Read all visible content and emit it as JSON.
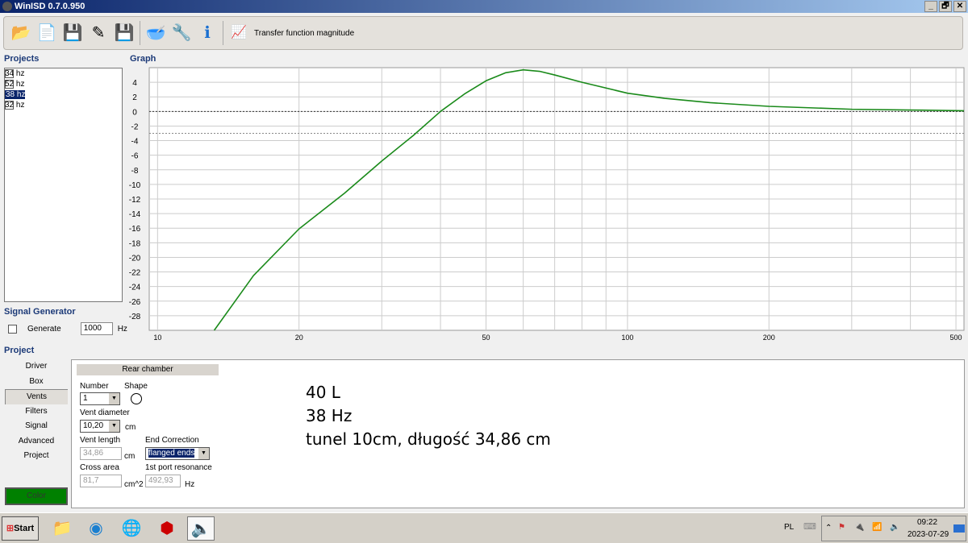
{
  "window": {
    "title": "WinISD 0.7.0.950",
    "min": "_",
    "max": "🗗",
    "close": "✕"
  },
  "toolbar": {
    "open": "📂",
    "new": "📄",
    "save": "💾",
    "save_as": "✎",
    "save_all": "💾",
    "driver": "🥣",
    "tools": "🔧",
    "info": "ℹ",
    "graph_type": "Transfer function magnitude"
  },
  "projects": {
    "title": "Projects",
    "items": [
      {
        "label": "34 hz",
        "checked": false
      },
      {
        "label": "52 hz",
        "checked": false
      },
      {
        "label": "38 hz",
        "checked": true,
        "selected": true
      },
      {
        "label": "32 hz",
        "checked": false
      }
    ]
  },
  "graph": {
    "title": "Graph"
  },
  "signal_generator": {
    "title": "Signal Generator",
    "generate_label": "Generate",
    "freq": "1000",
    "unit": "Hz"
  },
  "project": {
    "title": "Project",
    "nav": [
      "Driver",
      "Box",
      "Vents",
      "Filters",
      "Signal",
      "Advanced",
      "Project"
    ],
    "active": "Vents",
    "color_label": "Color"
  },
  "vents": {
    "header": "Rear chamber",
    "number_label": "Number",
    "number": "1",
    "shape_label": "Shape",
    "diameter_label": "Vent diameter",
    "diameter": "10,20",
    "diameter_unit": "cm",
    "length_label": "Vent length",
    "length": "34,86",
    "length_unit": "cm",
    "end_corr_label": "End Correction",
    "end_corr": "flanged ends",
    "cross_label": "Cross area",
    "cross": "81,7",
    "cross_unit": "cm^2",
    "res_label": "1st port resonance",
    "res": "492,93",
    "res_unit": "Hz"
  },
  "notes": [
    "40 L",
    "38 Hz",
    "tunel 10cm, długość 34,86 cm"
  ],
  "taskbar": {
    "start": "Start",
    "lang": "PL",
    "time": "09:22",
    "date": "2023-07-29"
  },
  "chart_data": {
    "type": "line",
    "title": "Transfer function magnitude",
    "xscale": "log",
    "xlim": [
      9.6,
      520
    ],
    "ylim": [
      -30,
      6
    ],
    "xticks": [
      10,
      20,
      50,
      100,
      200,
      500
    ],
    "yticks": [
      4,
      2,
      0,
      -2,
      -4,
      -6,
      -8,
      -10,
      -12,
      -14,
      -16,
      -18,
      -20,
      -22,
      -24,
      -26,
      -28
    ],
    "reference_lines": [
      0,
      -3
    ],
    "series": [
      {
        "name": "38 hz",
        "color": "#1a8a1a",
        "x": [
          13.2,
          16,
          20,
          25,
          30,
          35,
          40,
          45,
          50,
          55,
          60,
          65,
          70,
          80,
          100,
          120,
          150,
          200,
          300,
          400,
          520
        ],
        "y": [
          -30,
          -22.5,
          -16.1,
          -11.2,
          -6.8,
          -3.3,
          0,
          2.4,
          4.2,
          5.3,
          5.7,
          5.5,
          5.0,
          4.0,
          2.5,
          1.8,
          1.2,
          0.7,
          0.3,
          0.2,
          0.1
        ]
      }
    ]
  }
}
